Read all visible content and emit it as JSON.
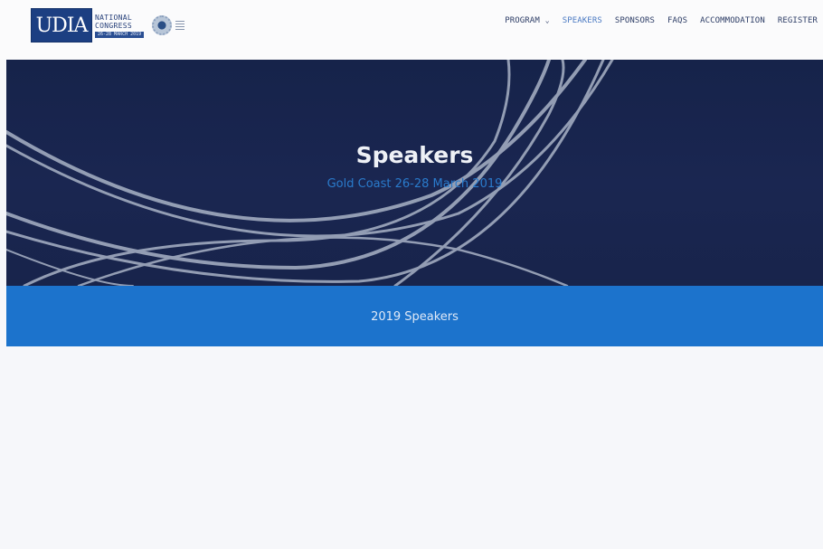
{
  "logo": {
    "mark": "UDIA",
    "line1": "NATIONAL",
    "line2": "CONGRESS",
    "dates": "26-28 MARCH 2019"
  },
  "nav": {
    "program": "PROGRAM",
    "speakers": "SPEAKERS",
    "sponsors": "SPONSORS",
    "faqs": "FAQS",
    "accommodation": "ACCOMMODATION",
    "register": "REGISTER"
  },
  "hero": {
    "title": "Speakers",
    "subtitle": "Gold Coast 26-28 March 2019"
  },
  "band": {
    "heading": "2019 Speakers"
  },
  "colors": {
    "nav_text": "#2d3d66",
    "nav_active": "#4a79c2",
    "hero_bg": "#16234a",
    "subtitle": "#2a7bcc",
    "band_bg": "#1c73cc"
  }
}
